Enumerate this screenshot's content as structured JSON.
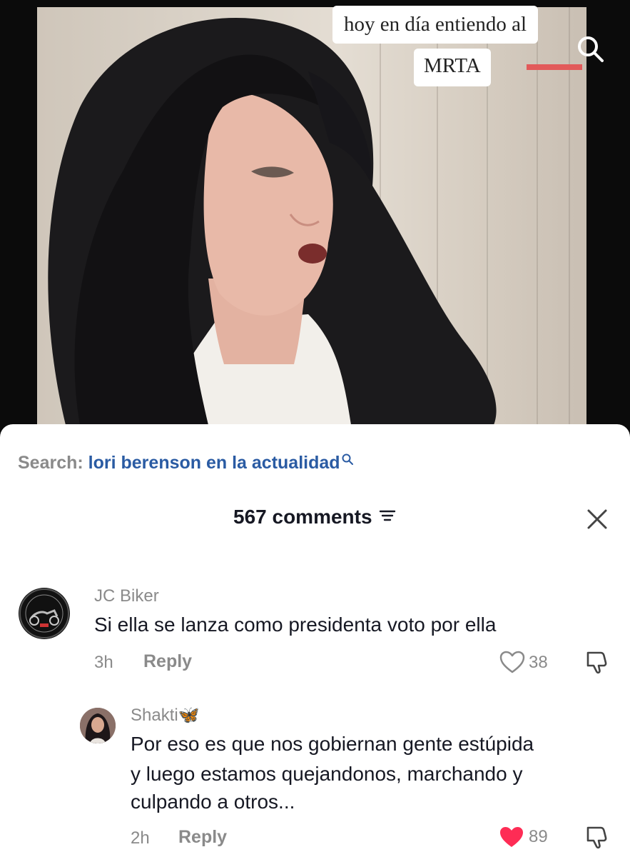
{
  "video": {
    "caption_line1": "hoy en día entiendo al",
    "caption_line2": "MRTA",
    "search_icon": "search-icon"
  },
  "search": {
    "prefix": "Search:",
    "query": "lori berenson en la actualidad",
    "link_color": "#2a5ba3"
  },
  "comments_header": {
    "count_label": "567 comments",
    "filter_icon": "filter-icon",
    "close_icon": "close-icon"
  },
  "comments": [
    {
      "username": "JC Biker",
      "text": "Si ella se lanza como presidenta voto por ella",
      "time": "3h",
      "reply_label": "Reply",
      "likes": "38",
      "liked": false
    },
    {
      "username": "Shakti🦋",
      "text_lines": [
        "Por eso es que nos gobiernan gente estúpida",
        "y luego estamos quejandonos, marchando y",
        "culpando a otros..."
      ],
      "time": "2h",
      "reply_label": "Reply",
      "likes": "89",
      "liked": true,
      "liked_color": "#fe2c55"
    }
  ]
}
